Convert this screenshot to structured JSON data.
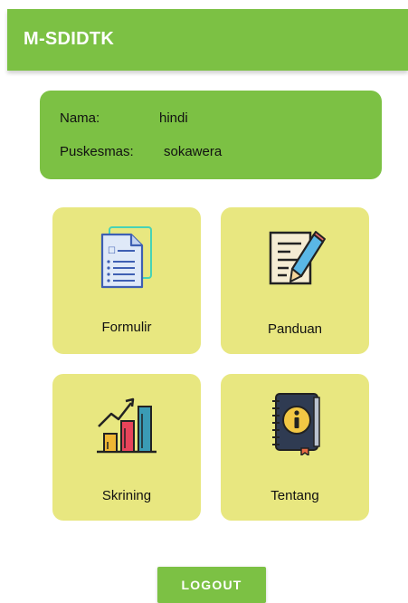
{
  "appbar": {
    "title": "M-SDIDTK"
  },
  "colors": {
    "primary": "#7cc144",
    "card": "#e8e780"
  },
  "profile": {
    "nama_label": "Nama:",
    "nama_value": "hindi",
    "puskesmas_label": "Puskesmas:",
    "puskesmas_value": "sokawera"
  },
  "menu": [
    {
      "label": "Formulir",
      "icon": "document-form-icon"
    },
    {
      "label": "Panduan",
      "icon": "guide-pencil-icon"
    },
    {
      "label": "Skrining",
      "icon": "bar-chart-growth-icon"
    },
    {
      "label": "Tentang",
      "icon": "info-book-icon"
    }
  ],
  "logout_label": "LOGOUT"
}
